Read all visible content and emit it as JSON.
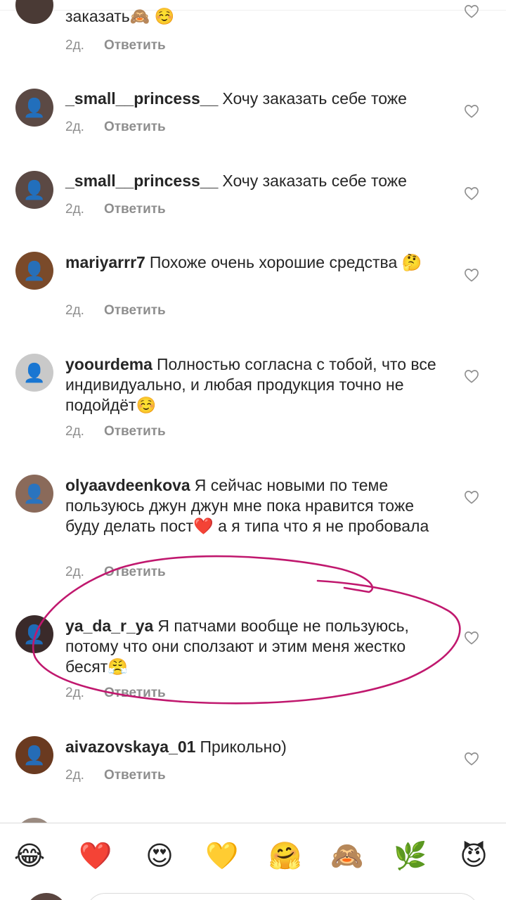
{
  "comments": [
    {
      "username": "",
      "text": "заказать🙈 ☺️",
      "time": "2д.",
      "reply": "Ответить",
      "avatar_color": "#4a3a35"
    },
    {
      "username": "_small__princess__",
      "text": "Хочу заказать себе тоже",
      "time": "2д.",
      "reply": "Ответить",
      "avatar_color": "#5b4944"
    },
    {
      "username": "_small__princess__",
      "text": "Хочу заказать себе тоже",
      "time": "2д.",
      "reply": "Ответить",
      "avatar_color": "#5b4944"
    },
    {
      "username": "mariyarrr7",
      "text": "Похоже очень хорошие средства 🤔",
      "time": "2д.",
      "reply": "Ответить",
      "avatar_color": "#7a4a2a"
    },
    {
      "username": "yoourdema",
      "text": "Полностью согласна с тобой, что все индивидуально, и любая продукция точно не подойдёт☺️",
      "time": "2д.",
      "reply": "Ответить",
      "avatar_color": "#c9c9c9"
    },
    {
      "username": "olyaavdeenkova",
      "text": "Я сейчас новыми по теме пользуюсь джун джун мне пока нравится тоже буду делать пост❤️  а я типа что я не пробовала",
      "time": "2д.",
      "reply": "Ответить",
      "avatar_color": "#8a6a5a"
    },
    {
      "username": "ya_da_r_ya",
      "text": "Я патчами вообще не пользуюсь, потому что они сползают и этим меня жестко бесят😤",
      "time": "2д.",
      "reply": "Ответить",
      "avatar_color": "#3a2a2a"
    },
    {
      "username": "aivazovskaya_01",
      "text": "Прикольно)",
      "time": "2д.",
      "reply": "Ответить",
      "avatar_color": "#6a3a20"
    }
  ],
  "emoji_bar": [
    "😂",
    "❤️",
    "😍",
    "💛",
    "🤗",
    "🙈",
    "🌿",
    "😈"
  ],
  "colors": {
    "annotation_circle": "#c0186e",
    "meta_text": "#8e8e8e"
  }
}
